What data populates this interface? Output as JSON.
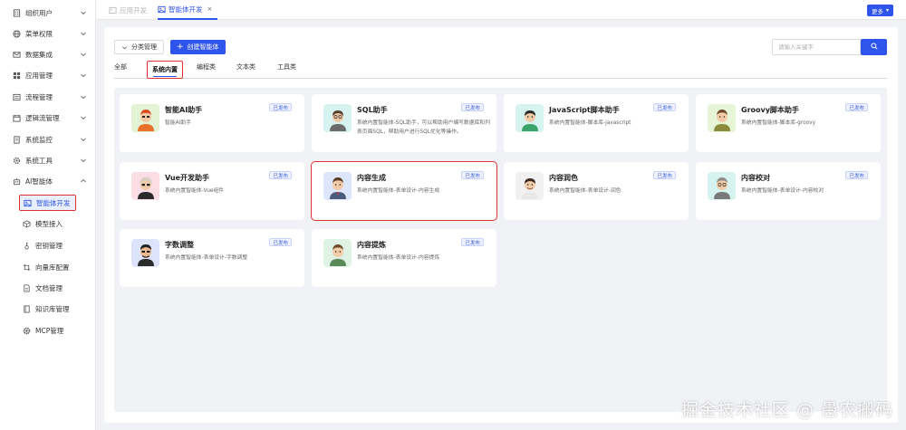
{
  "sidebar": {
    "items": [
      {
        "label": "组织用户",
        "icon": "building-icon"
      },
      {
        "label": "菜单权限",
        "icon": "globe-icon"
      },
      {
        "label": "数据集成",
        "icon": "mail-icon"
      },
      {
        "label": "应用管理",
        "icon": "grid-icon"
      },
      {
        "label": "流程管理",
        "icon": "flow-icon"
      },
      {
        "label": "逻辑流管理",
        "icon": "calendar-icon"
      },
      {
        "label": "系统监控",
        "icon": "document-icon"
      },
      {
        "label": "系统工具",
        "icon": "gear-icon"
      },
      {
        "label": "AI智能体",
        "icon": "robot-icon"
      }
    ],
    "sub_items": [
      {
        "label": "智能体开发",
        "icon": "image-icon"
      },
      {
        "label": "模型接入",
        "icon": "cube-icon"
      },
      {
        "label": "密钥管理",
        "icon": "key-icon"
      },
      {
        "label": "向量库配置",
        "icon": "crop-icon"
      },
      {
        "label": "文档管理",
        "icon": "file-icon"
      },
      {
        "label": "知识库管理",
        "icon": "book-icon"
      },
      {
        "label": "MCP管理",
        "icon": "cog-icon"
      }
    ]
  },
  "topbar": {
    "tab_inactive": "应用开发",
    "tab_active": "智能体开发",
    "close": "×",
    "more": "更多"
  },
  "toolbar": {
    "category_btn": "分类管理",
    "create_btn": "创建智能体",
    "search_placeholder": "请输入关键字"
  },
  "category_tabs": [
    "全部",
    "系统内置",
    "编程类",
    "文本类",
    "工具类"
  ],
  "accent": "#2f54eb",
  "highlight": "#e03131",
  "cards": [
    {
      "title": "智能AI助手",
      "desc": "智能AI助手",
      "badge": "已发布",
      "avatar_bg": "#e3f3d4"
    },
    {
      "title": "SQL助手",
      "desc": "系统内置智能体-SQL助手，可以帮助用户编写数据库和列表页面SQL，帮助用户进行SQL优化等操作。",
      "badge": "已发布",
      "avatar_bg": "#d6f3ef"
    },
    {
      "title": "JavaScript脚本助手",
      "desc": "系统内置智能体-脚本库-javascript",
      "badge": "已发布",
      "avatar_bg": "#d6f3ef"
    },
    {
      "title": "Groovy脚本助手",
      "desc": "系统内置智能体-脚本库-groovy",
      "badge": "已发布",
      "avatar_bg": "#e6f5d6"
    },
    {
      "title": "Vue开发助手",
      "desc": "系统内置智能体-Vue组件",
      "badge": "已发布",
      "avatar_bg": "#fbdde6"
    },
    {
      "title": "内容生成",
      "desc": "系统内置智能体-表单设计-内容生成",
      "badge": "已发布",
      "avatar_bg": "#dde6fb"
    },
    {
      "title": "内容润色",
      "desc": "系统内置智能体-表单设计-润色",
      "badge": "已发布",
      "avatar_bg": "#f1f1f1"
    },
    {
      "title": "内容校对",
      "desc": "系统内置智能体-表单设计-内容校对",
      "badge": "已发布",
      "avatar_bg": "#d6f3ef"
    },
    {
      "title": "字数调整",
      "desc": "系统内置智能体-表单设计-字数调整",
      "badge": "已发布",
      "avatar_bg": "#dde3fb"
    },
    {
      "title": "内容提炼",
      "desc": "系统内置智能体-表单设计-内容提炼",
      "badge": "已发布",
      "avatar_bg": "#dff3e4"
    }
  ],
  "watermark": "掘金技术社区 @ 愚农搬码"
}
